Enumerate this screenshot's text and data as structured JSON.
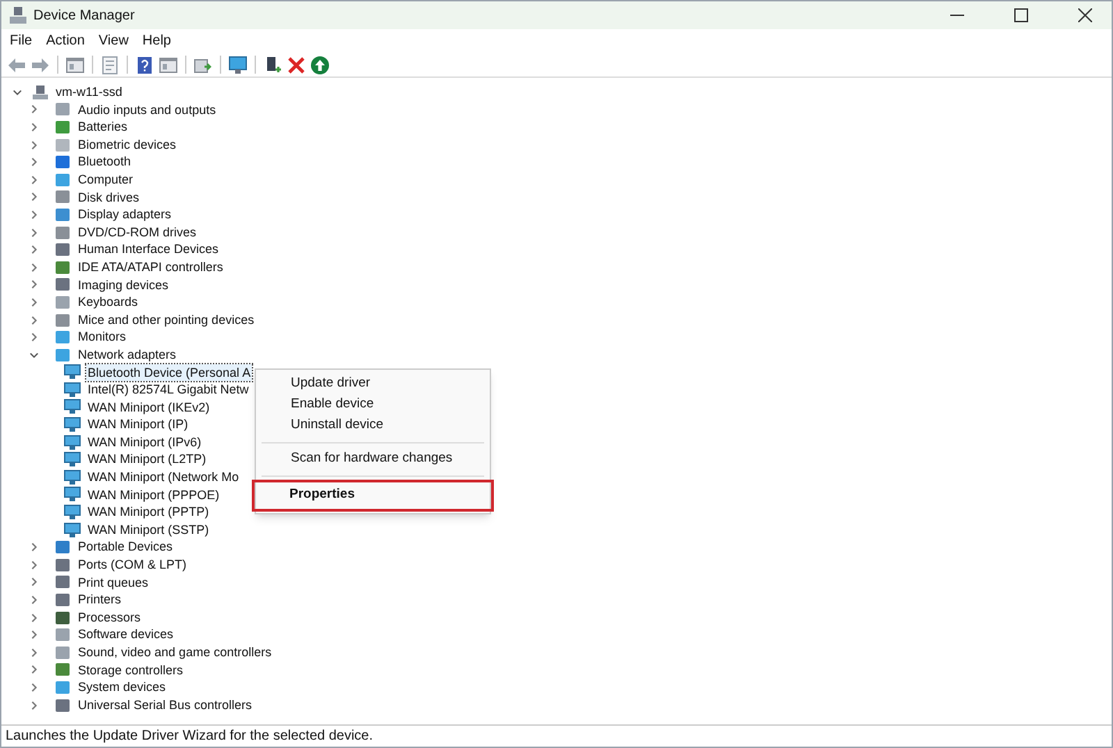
{
  "window": {
    "title": "Device Manager"
  },
  "menu": [
    {
      "label": "File"
    },
    {
      "label": "Action"
    },
    {
      "label": "View"
    },
    {
      "label": "Help"
    }
  ],
  "toolbar": [
    {
      "kind": "back"
    },
    {
      "kind": "forward"
    },
    {
      "kind": "sep"
    },
    {
      "kind": "console"
    },
    {
      "kind": "sep"
    },
    {
      "kind": "properties"
    },
    {
      "kind": "sep"
    },
    {
      "kind": "help"
    },
    {
      "kind": "console"
    },
    {
      "kind": "sep"
    },
    {
      "kind": "update"
    },
    {
      "kind": "sep"
    },
    {
      "kind": "monitor"
    },
    {
      "kind": "sep"
    },
    {
      "kind": "enable"
    },
    {
      "kind": "remove"
    },
    {
      "kind": "scan"
    }
  ],
  "tree": {
    "label": "vm-w11-ssd",
    "expanded": true,
    "selected": false,
    "children": [
      {
        "label": "Audio inputs and outputs",
        "expanded": false,
        "selected": false,
        "color": "#9aa3ad"
      },
      {
        "label": "Batteries",
        "expanded": false,
        "selected": false,
        "color": "#3f9b3f"
      },
      {
        "label": "Biometric devices",
        "expanded": false,
        "selected": false,
        "color": "#b0b6bd"
      },
      {
        "label": "Bluetooth",
        "expanded": false,
        "selected": false,
        "color": "#1e6fd9"
      },
      {
        "label": "Computer",
        "expanded": false,
        "selected": false,
        "color": "#3da4e0"
      },
      {
        "label": "Disk drives",
        "expanded": false,
        "selected": false,
        "color": "#8a9098"
      },
      {
        "label": "Display adapters",
        "expanded": false,
        "selected": false,
        "color": "#3d8fd0"
      },
      {
        "label": "DVD/CD-ROM drives",
        "expanded": false,
        "selected": false,
        "color": "#8a9098"
      },
      {
        "label": "Human Interface Devices",
        "expanded": false,
        "selected": false,
        "color": "#6b7280"
      },
      {
        "label": "IDE ATA/ATAPI controllers",
        "expanded": false,
        "selected": false,
        "color": "#4b8a3c"
      },
      {
        "label": "Imaging devices",
        "expanded": false,
        "selected": false,
        "color": "#6b7280"
      },
      {
        "label": "Keyboards",
        "expanded": false,
        "selected": false,
        "color": "#9aa3ad"
      },
      {
        "label": "Mice and other pointing devices",
        "expanded": false,
        "selected": false,
        "color": "#8a9098"
      },
      {
        "label": "Monitors",
        "expanded": false,
        "selected": false,
        "color": "#3da4e0"
      },
      {
        "label": "Network adapters",
        "expanded": true,
        "selected": false,
        "color": "#3da4e0",
        "children": [
          {
            "label": "Bluetooth Device (Personal A",
            "selected": true
          },
          {
            "label": "Intel(R) 82574L Gigabit Netw",
            "selected": false
          },
          {
            "label": "WAN Miniport (IKEv2)",
            "selected": false
          },
          {
            "label": "WAN Miniport (IP)",
            "selected": false
          },
          {
            "label": "WAN Miniport (IPv6)",
            "selected": false
          },
          {
            "label": "WAN Miniport (L2TP)",
            "selected": false
          },
          {
            "label": "WAN Miniport (Network Mo",
            "selected": false
          },
          {
            "label": "WAN Miniport (PPPOE)",
            "selected": false
          },
          {
            "label": "WAN Miniport (PPTP)",
            "selected": false
          },
          {
            "label": "WAN Miniport (SSTP)",
            "selected": false
          }
        ]
      },
      {
        "label": "Portable Devices",
        "expanded": false,
        "selected": false,
        "color": "#2f7fc8"
      },
      {
        "label": "Ports (COM & LPT)",
        "expanded": false,
        "selected": false,
        "color": "#6b7280"
      },
      {
        "label": "Print queues",
        "expanded": false,
        "selected": false,
        "color": "#6b7280"
      },
      {
        "label": "Printers",
        "expanded": false,
        "selected": false,
        "color": "#6b7280"
      },
      {
        "label": "Processors",
        "expanded": false,
        "selected": false,
        "color": "#3f5f3f"
      },
      {
        "label": "Software devices",
        "expanded": false,
        "selected": false,
        "color": "#9aa3ad"
      },
      {
        "label": "Sound, video and game controllers",
        "expanded": false,
        "selected": false,
        "color": "#9aa3ad"
      },
      {
        "label": "Storage controllers",
        "expanded": false,
        "selected": false,
        "color": "#4b8a3c"
      },
      {
        "label": "System devices",
        "expanded": false,
        "selected": false,
        "color": "#3da4e0"
      },
      {
        "label": "Universal Serial Bus controllers",
        "expanded": false,
        "selected": false,
        "color": "#6b7280"
      }
    ]
  },
  "context_menu": [
    {
      "label": "Update driver",
      "separator_before": false,
      "default": false,
      "highlighted": false
    },
    {
      "label": "Enable device",
      "separator_before": false,
      "default": false,
      "highlighted": false
    },
    {
      "label": "Uninstall device",
      "separator_before": false,
      "default": false,
      "highlighted": false
    },
    {
      "label": "Scan for hardware changes",
      "separator_before": true,
      "default": false,
      "highlighted": false
    },
    {
      "label": "Properties",
      "separator_before": true,
      "default": true,
      "highlighted": true
    }
  ],
  "status_bar": "Launches the Update Driver Wizard for the selected device."
}
